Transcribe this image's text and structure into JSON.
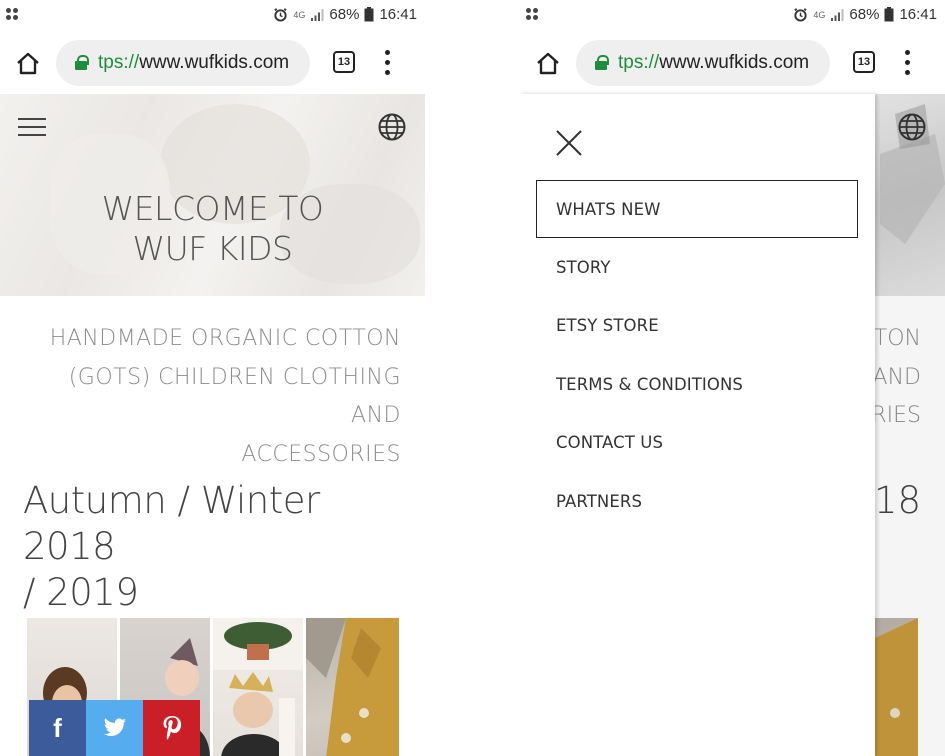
{
  "status": {
    "network": "4G",
    "battery": "68%",
    "time": "16:41"
  },
  "browser": {
    "url_scheme": "tps://",
    "url_host": "www.wufkids.com",
    "tab_count": "13"
  },
  "hero": {
    "title_line1": "WELCOME TO",
    "title_line2": "WUF KIDS"
  },
  "tagline": {
    "line1": "HANDMADE ORGANIC COTTON",
    "line2": "(GOTS) CHILDREN CLOTHING AND",
    "line3": "ACCESSORIES"
  },
  "collection": {
    "title_line1": "Autumn / Winter 2018",
    "title_line2": "/ 2019"
  },
  "share": {
    "facebook": "f"
  },
  "menu": {
    "items": [
      {
        "label": "WHATS NEW",
        "active": true
      },
      {
        "label": "STORY"
      },
      {
        "label": "ETSY STORE"
      },
      {
        "label": "TERMS & CONDITIONS"
      },
      {
        "label": "CONTACT US"
      },
      {
        "label": "PARTNERS"
      }
    ]
  },
  "peek": {
    "tagline1": "TON",
    "tagline2": "AND",
    "tagline3": "RIES",
    "season": "18"
  },
  "icons": {
    "home": "home-icon",
    "lock": "lock-icon",
    "tabs": "tabs-icon",
    "more": "more-vert-icon",
    "menu": "hamburger-icon",
    "language": "globe-icon",
    "close": "close-icon",
    "facebook": "facebook-icon",
    "twitter": "twitter-icon",
    "pinterest": "pinterest-icon"
  },
  "colors": {
    "secure": "#1e8e3e",
    "facebook": "#3b5b9a",
    "twitter": "#55acee",
    "pinterest": "#cb1f27"
  }
}
